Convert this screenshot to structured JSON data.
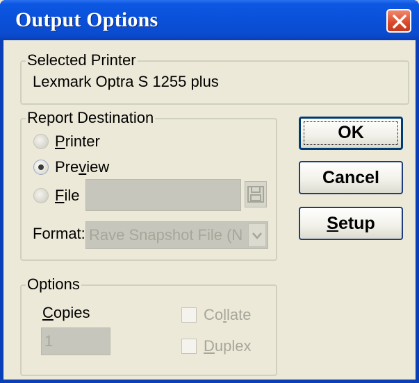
{
  "window": {
    "title": "Output Options"
  },
  "selected_printer": {
    "legend": "Selected Printer",
    "value": "Lexmark Optra S 1255 plus"
  },
  "report_destination": {
    "legend": "Report Destination",
    "options": [
      {
        "pre": "",
        "u": "P",
        "post": "rinter",
        "selected": false
      },
      {
        "pre": "Pre",
        "u": "v",
        "post": "iew",
        "selected": true
      },
      {
        "pre": "",
        "u": "F",
        "post": "ile",
        "selected": false
      }
    ],
    "file_path": "",
    "format_label": "Format:",
    "format_value": "Rave Snapshot File (ND"
  },
  "options": {
    "legend": "Options",
    "copies_label_u": "C",
    "copies_label_rest": "opies",
    "copies_value": "1",
    "collate_pre": "Co",
    "collate_u": "l",
    "collate_post": "late",
    "duplex_u": "D",
    "duplex_post": "uplex"
  },
  "buttons": {
    "ok": "OK",
    "cancel": "Cancel",
    "setup_u": "S",
    "setup_rest": "etup"
  },
  "icons": {
    "close": "close-icon",
    "save": "floppy-disk-icon",
    "dropdown": "chevron-down-icon"
  }
}
